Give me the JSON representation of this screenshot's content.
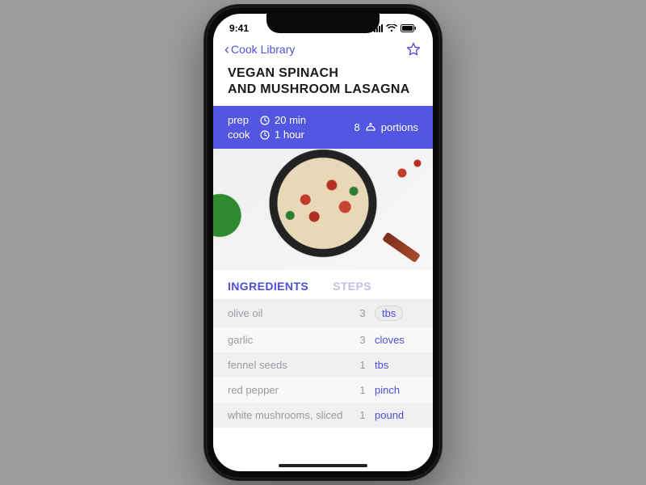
{
  "status": {
    "time": "9:41"
  },
  "nav": {
    "back_label": "Cook Library"
  },
  "recipe": {
    "title_line1": "VEGAN SPINACH",
    "title_line2": "AND MUSHROOM LASAGNA",
    "prep_label": "prep",
    "prep_value": "20 min",
    "cook_label": "cook",
    "cook_value": "1 hour",
    "portions_value": "8",
    "portions_label": "portions"
  },
  "tabs": {
    "ingredients": "INGREDIENTS",
    "steps": "STEPS"
  },
  "ingredients": [
    {
      "name": "olive oil",
      "qty": "3",
      "unit": "tbs",
      "chip": true
    },
    {
      "name": "garlic",
      "qty": "3",
      "unit": "cloves",
      "chip": false
    },
    {
      "name": "fennel seeds",
      "qty": "1",
      "unit": "tbs",
      "chip": false
    },
    {
      "name": "red pepper",
      "qty": "1",
      "unit": "pinch",
      "chip": false
    },
    {
      "name": "white mushrooms, sliced",
      "qty": "1",
      "unit": "pound",
      "chip": false
    }
  ]
}
